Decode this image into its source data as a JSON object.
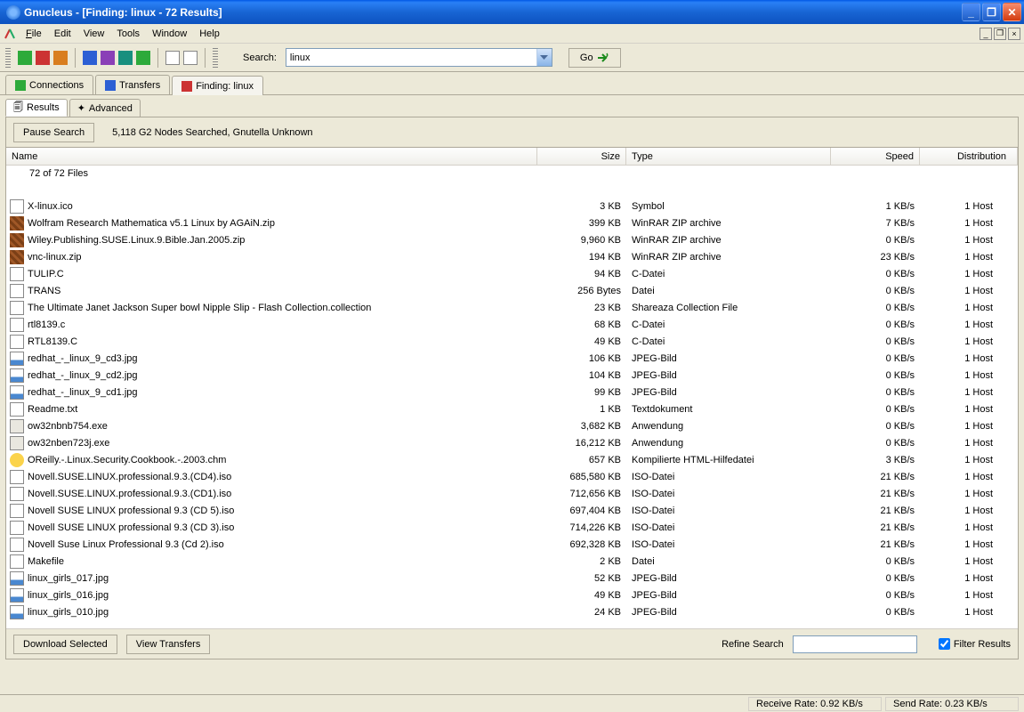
{
  "title_bar": {
    "text": "Gnucleus - [Finding: linux - 72 Results]"
  },
  "menu": {
    "file": "File",
    "edit": "Edit",
    "view": "View",
    "tools": "Tools",
    "window": "Window",
    "help": "Help"
  },
  "toolbar": {
    "search_label": "Search:",
    "search_value": "linux",
    "go_label": "Go"
  },
  "child_tabs": {
    "connections": "Connections",
    "transfers": "Transfers",
    "finding": "Finding: linux"
  },
  "sub_tabs": {
    "results": "Results",
    "advanced": "Advanced"
  },
  "actions": {
    "pause_search": "Pause Search",
    "status": "5,118 G2 Nodes Searched, Gnutella Unknown"
  },
  "columns": {
    "name": "Name",
    "size": "Size",
    "type": "Type",
    "speed": "Speed",
    "distribution": "Distribution"
  },
  "count_line": "72 of 72 Files",
  "files": [
    {
      "ic": "ic-file",
      "name": "X-linux.ico",
      "size": "3 KB",
      "type": "Symbol",
      "speed": "1 KB/s",
      "dist": "1 Host"
    },
    {
      "ic": "ic-zip",
      "name": "Wolfram Research Mathematica v5.1 Linux by AGAiN.zip",
      "size": "399 KB",
      "type": "WinRAR ZIP archive",
      "speed": "7 KB/s",
      "dist": "1 Host"
    },
    {
      "ic": "ic-zip",
      "name": "Wiley.Publishing.SUSE.Linux.9.Bible.Jan.2005.zip",
      "size": "9,960 KB",
      "type": "WinRAR ZIP archive",
      "speed": "0 KB/s",
      "dist": "1 Host"
    },
    {
      "ic": "ic-zip",
      "name": "vnc-linux.zip",
      "size": "194 KB",
      "type": "WinRAR ZIP archive",
      "speed": "23 KB/s",
      "dist": "1 Host"
    },
    {
      "ic": "ic-file",
      "name": "TULIP.C",
      "size": "94 KB",
      "type": "C-Datei",
      "speed": "0 KB/s",
      "dist": "1 Host"
    },
    {
      "ic": "ic-file",
      "name": "TRANS",
      "size": "256 Bytes",
      "type": "Datei",
      "speed": "0 KB/s",
      "dist": "1 Host"
    },
    {
      "ic": "ic-file",
      "name": "The Ultimate Janet Jackson Super bowl Nipple Slip - Flash Collection.collection",
      "size": "23 KB",
      "type": "Shareaza Collection File",
      "speed": "0 KB/s",
      "dist": "1 Host"
    },
    {
      "ic": "ic-file",
      "name": "rtl8139.c",
      "size": "68 KB",
      "type": "C-Datei",
      "speed": "0 KB/s",
      "dist": "1 Host"
    },
    {
      "ic": "ic-file",
      "name": "RTL8139.C",
      "size": "49 KB",
      "type": "C-Datei",
      "speed": "0 KB/s",
      "dist": "1 Host"
    },
    {
      "ic": "ic-img",
      "name": "redhat_-_linux_9_cd3.jpg",
      "size": "106 KB",
      "type": "JPEG-Bild",
      "speed": "0 KB/s",
      "dist": "1 Host"
    },
    {
      "ic": "ic-img",
      "name": "redhat_-_linux_9_cd2.jpg",
      "size": "104 KB",
      "type": "JPEG-Bild",
      "speed": "0 KB/s",
      "dist": "1 Host"
    },
    {
      "ic": "ic-img",
      "name": "redhat_-_linux_9_cd1.jpg",
      "size": "99 KB",
      "type": "JPEG-Bild",
      "speed": "0 KB/s",
      "dist": "1 Host"
    },
    {
      "ic": "ic-file",
      "name": "Readme.txt",
      "size": "1 KB",
      "type": "Textdokument",
      "speed": "0 KB/s",
      "dist": "1 Host"
    },
    {
      "ic": "ic-exe",
      "name": "ow32nbnb754.exe",
      "size": "3,682 KB",
      "type": "Anwendung",
      "speed": "0 KB/s",
      "dist": "1 Host"
    },
    {
      "ic": "ic-exe",
      "name": "ow32nben723j.exe",
      "size": "16,212 KB",
      "type": "Anwendung",
      "speed": "0 KB/s",
      "dist": "1 Host"
    },
    {
      "ic": "ic-help",
      "name": "OReilly.-.Linux.Security.Cookbook.-.2003.chm",
      "size": "657 KB",
      "type": "Kompilierte HTML-Hilfedatei",
      "speed": "3 KB/s",
      "dist": "1 Host"
    },
    {
      "ic": "ic-file",
      "name": "Novell.SUSE.LINUX.professional.9.3.(CD4).iso",
      "size": "685,580 KB",
      "type": "ISO-Datei",
      "speed": "21 KB/s",
      "dist": "1 Host"
    },
    {
      "ic": "ic-file",
      "name": "Novell.SUSE.LINUX.professional.9.3.(CD1).iso",
      "size": "712,656 KB",
      "type": "ISO-Datei",
      "speed": "21 KB/s",
      "dist": "1 Host"
    },
    {
      "ic": "ic-file",
      "name": "Novell SUSE LINUX professional 9.3 (CD 5).iso",
      "size": "697,404 KB",
      "type": "ISO-Datei",
      "speed": "21 KB/s",
      "dist": "1 Host"
    },
    {
      "ic": "ic-file",
      "name": "Novell SUSE LINUX professional 9.3 (CD 3).iso",
      "size": "714,226 KB",
      "type": "ISO-Datei",
      "speed": "21 KB/s",
      "dist": "1 Host"
    },
    {
      "ic": "ic-file",
      "name": "Novell Suse Linux Professional 9.3 (Cd 2).iso",
      "size": "692,328 KB",
      "type": "ISO-Datei",
      "speed": "21 KB/s",
      "dist": "1 Host"
    },
    {
      "ic": "ic-file",
      "name": "Makefile",
      "size": "2 KB",
      "type": "Datei",
      "speed": "0 KB/s",
      "dist": "1 Host"
    },
    {
      "ic": "ic-img",
      "name": "linux_girls_017.jpg",
      "size": "52 KB",
      "type": "JPEG-Bild",
      "speed": "0 KB/s",
      "dist": "1 Host"
    },
    {
      "ic": "ic-img",
      "name": "linux_girls_016.jpg",
      "size": "49 KB",
      "type": "JPEG-Bild",
      "speed": "0 KB/s",
      "dist": "1 Host"
    },
    {
      "ic": "ic-img",
      "name": "linux_girls_010.jpg",
      "size": "24 KB",
      "type": "JPEG-Bild",
      "speed": "0 KB/s",
      "dist": "1 Host"
    }
  ],
  "bottom": {
    "download": "Download Selected",
    "view_transfers": "View Transfers",
    "refine_label": "Refine Search",
    "filter_label": "Filter Results",
    "filter_checked": true
  },
  "status": {
    "recv": "Receive Rate:  0.92 KB/s",
    "send": "Send Rate:  0.23 KB/s"
  }
}
